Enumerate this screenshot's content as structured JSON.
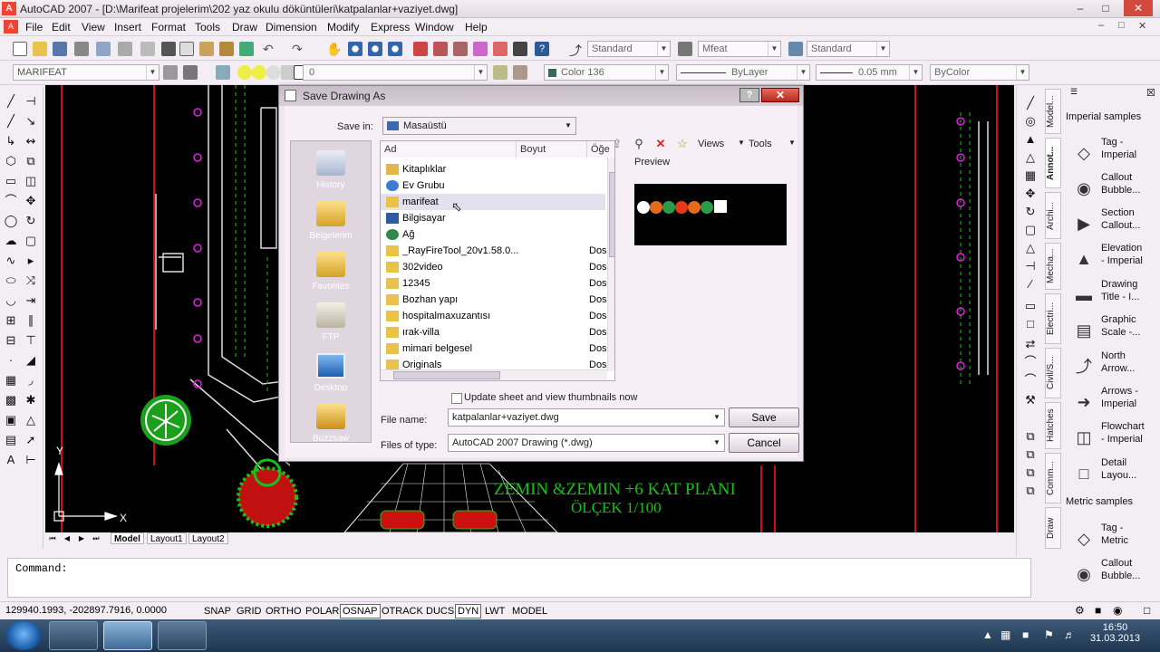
{
  "app": {
    "title": "AutoCAD 2007 - [D:\\Marifeat projelerim\\202 yaz okulu döküntüleri\\katpalanlar+vaziyet.dwg]"
  },
  "window_buttons": [
    "–",
    "□",
    "✕"
  ],
  "mdi_buttons": [
    "–",
    "□",
    "✕"
  ],
  "menu": [
    "File",
    "Edit",
    "View",
    "Insert",
    "Format",
    "Tools",
    "Draw",
    "Dimension",
    "Modify",
    "Express",
    "Window",
    "Help"
  ],
  "styles": {
    "text_style": "Standard",
    "dim_style": "Mfeat",
    "table_style": "Standard"
  },
  "layers": {
    "workspace": "MARIFEAT",
    "current_layer": "0",
    "color": "Color 136",
    "linetype": "ByLayer",
    "lineweight": "0.05 mm",
    "plotstyle": "ByColor"
  },
  "drawing": {
    "plan_title": "ZEMIN &ZEMIN +6 KAT PLANI",
    "scale": "ÖLÇEK 1/100",
    "ucs_x": "X",
    "ucs_y": "Y"
  },
  "tabs": [
    "Model",
    "Layout1",
    "Layout2"
  ],
  "command": {
    "prompt": "Command:"
  },
  "status": {
    "coords": "129940.1993, -202897.7916, 0.0000",
    "toggles": [
      {
        "label": "SNAP",
        "on": false
      },
      {
        "label": "GRID",
        "on": false
      },
      {
        "label": "ORTHO",
        "on": false
      },
      {
        "label": "POLAR",
        "on": false
      },
      {
        "label": "OSNAP",
        "on": true
      },
      {
        "label": "OTRACK",
        "on": false
      },
      {
        "label": "DUCS",
        "on": false
      },
      {
        "label": "DYN",
        "on": true
      },
      {
        "label": "LWT",
        "on": false
      },
      {
        "label": "MODEL",
        "on": false
      }
    ]
  },
  "palette": {
    "tabs": [
      "Model...",
      "Annot...",
      "Archi...",
      "Mecha...",
      "Electri...",
      "Civil/S...",
      "Hatches",
      "Comm...",
      "Draw"
    ],
    "imperial_header": "Imperial samples",
    "metric_header": "Metric samples",
    "imperial_items": [
      {
        "label": "Tag -\nImperial",
        "icon": "tag-icon"
      },
      {
        "label": "Callout\nBubble...",
        "icon": "callout-icon"
      },
      {
        "label": "Section\nCallout...",
        "icon": "section-icon"
      },
      {
        "label": "Elevation\n- Imperial",
        "icon": "elevation-icon"
      },
      {
        "label": "Drawing\nTitle - I...",
        "icon": "title-icon"
      },
      {
        "label": "Graphic\nScale -...",
        "icon": "scale-icon"
      },
      {
        "label": "North\nArrow...",
        "icon": "north-arrow-icon"
      },
      {
        "label": "Arrows -\nImperial",
        "icon": "arrows-icon"
      },
      {
        "label": "Flowchart\n- Imperial",
        "icon": "flowchart-icon"
      },
      {
        "label": "Detail\nLayou...",
        "icon": "detail-icon"
      }
    ],
    "metric_items": [
      {
        "label": "Tag -\nMetric",
        "icon": "tag-icon"
      },
      {
        "label": "Callout\nBubble...",
        "icon": "callout-icon"
      }
    ]
  },
  "dialog": {
    "title": "Save Drawing As",
    "help": "?",
    "close": "✕",
    "save_in_label": "Save in:",
    "save_in_value": "Masaüstü",
    "views_label": "Views",
    "tools_label": "Tools",
    "preview_label": "Preview",
    "columns": [
      "Ad",
      "Boyut",
      "Öğe"
    ],
    "places": [
      "History",
      "Belgelerim",
      "Favorites",
      "FTP",
      "Desktop",
      "Buzzsaw"
    ],
    "files": [
      {
        "name": "Kitaplıklar",
        "type": "",
        "icon": "library-icon"
      },
      {
        "name": "Ev Grubu",
        "type": "",
        "icon": "homegroup-icon"
      },
      {
        "name": "marifeat",
        "type": "",
        "icon": "folder-icon",
        "selected": true
      },
      {
        "name": "Bilgisayar",
        "type": "",
        "icon": "computer-icon"
      },
      {
        "name": "Ağ",
        "type": "",
        "icon": "network-icon"
      },
      {
        "name": "_RayFireTool_20v1.58.0...",
        "type": "Dos",
        "icon": "folder-icon"
      },
      {
        "name": "302video",
        "type": "Dos",
        "icon": "folder-icon"
      },
      {
        "name": "12345",
        "type": "Dos",
        "icon": "folder-icon"
      },
      {
        "name": "Bozhan yapı",
        "type": "Dos",
        "icon": "folder-icon"
      },
      {
        "name": "hospitalmaxuzantısı",
        "type": "Dos",
        "icon": "folder-icon"
      },
      {
        "name": "ırak-villa",
        "type": "Dos",
        "icon": "folder-icon"
      },
      {
        "name": "mimari belgesel",
        "type": "Dos",
        "icon": "folder-icon"
      },
      {
        "name": "Originals",
        "type": "Dos",
        "icon": "folder-icon"
      }
    ],
    "thumbnail_checkbox": "Update sheet and view thumbnails now",
    "filename_label": "File name:",
    "filename_value": "katpalanlar+vaziyet.dwg",
    "filetype_label": "Files of type:",
    "filetype_value": "AutoCAD 2007 Drawing (*.dwg)",
    "save_button": "Save",
    "cancel_button": "Cancel"
  },
  "taskbar": {
    "time": "16:50",
    "date": "31.03.2013"
  }
}
